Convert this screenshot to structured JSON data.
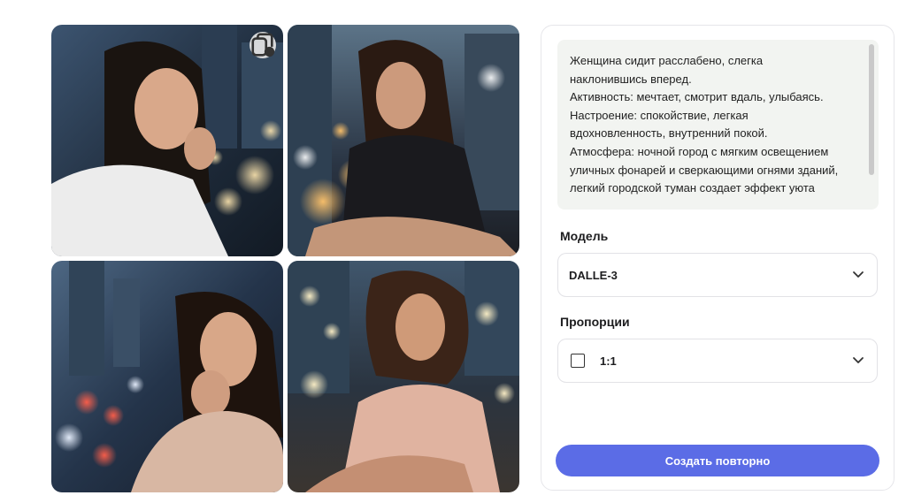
{
  "gallery": {
    "images": [
      {
        "name": "generated-image-1"
      },
      {
        "name": "generated-image-2"
      },
      {
        "name": "generated-image-3"
      },
      {
        "name": "generated-image-4"
      }
    ],
    "copy_icon": "copy-icon"
  },
  "prompt": {
    "text": "Женщина сидит расслабено, слегка\nнаклонившись вперед.\nАктивность: мечтает, смотрит вдаль, улыбаясь.\nНастроение: спокойствие, легкая\nвдохновленность, внутренний покой.\nАтмосфера: ночной город с мягким освещением\nуличных фонарей и сверкающими огнями зданий,\nлегкий городской туман создает эффект уюта"
  },
  "model": {
    "label": "Модель",
    "selected": "DALLE-3"
  },
  "proportions": {
    "label": "Пропорции",
    "selected": "1:1",
    "icon": "square-icon"
  },
  "actions": {
    "regenerate_label": "Создать повторно",
    "accent": "#5b6ce6"
  }
}
